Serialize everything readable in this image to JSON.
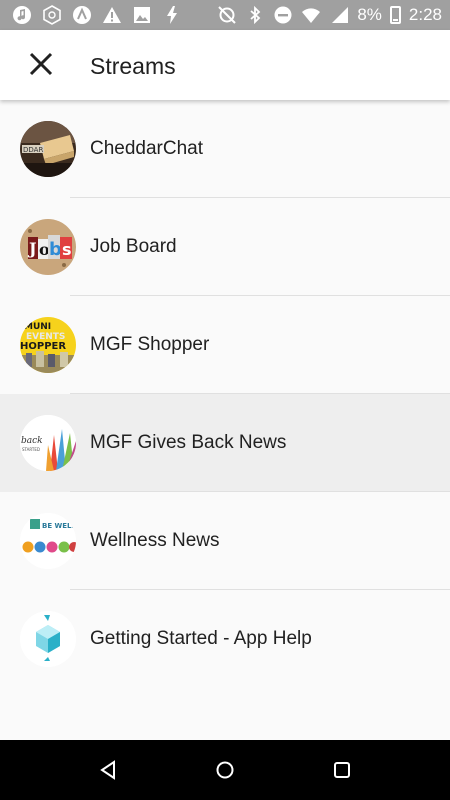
{
  "status_bar": {
    "battery_percent": "8%",
    "time": "2:28",
    "icons": [
      "music-icon",
      "hex-app-icon",
      "tunes-icon",
      "warning-icon",
      "image-icon",
      "flash-icon",
      "sync-off-icon",
      "bluetooth-icon",
      "dnd-icon",
      "wifi-icon",
      "signal-icon",
      "battery-icon"
    ]
  },
  "app_bar": {
    "title": "Streams",
    "close_icon": "close-icon"
  },
  "streams": [
    {
      "label": "CheddarChat",
      "icon": "cheddarchat-avatar",
      "highlighted": false
    },
    {
      "label": "Job Board",
      "icon": "job-board-avatar",
      "highlighted": false
    },
    {
      "label": "MGF Shopper",
      "icon": "mgf-shopper-avatar",
      "highlighted": false
    },
    {
      "label": "MGF Gives Back News",
      "icon": "gives-back-avatar",
      "highlighted": true
    },
    {
      "label": "Wellness News",
      "icon": "wellness-avatar",
      "highlighted": false
    },
    {
      "label": "Getting Started - App Help",
      "icon": "app-help-avatar",
      "highlighted": false
    }
  ],
  "nav_bar": {
    "buttons": [
      "back-icon",
      "home-icon",
      "recents-icon"
    ]
  },
  "colors": {
    "status_bar": "#a0a0a0",
    "app_bar": "#ffffff",
    "list_background": "#fafafa",
    "highlight": "#eeeeee",
    "nav_bar": "#000000"
  }
}
